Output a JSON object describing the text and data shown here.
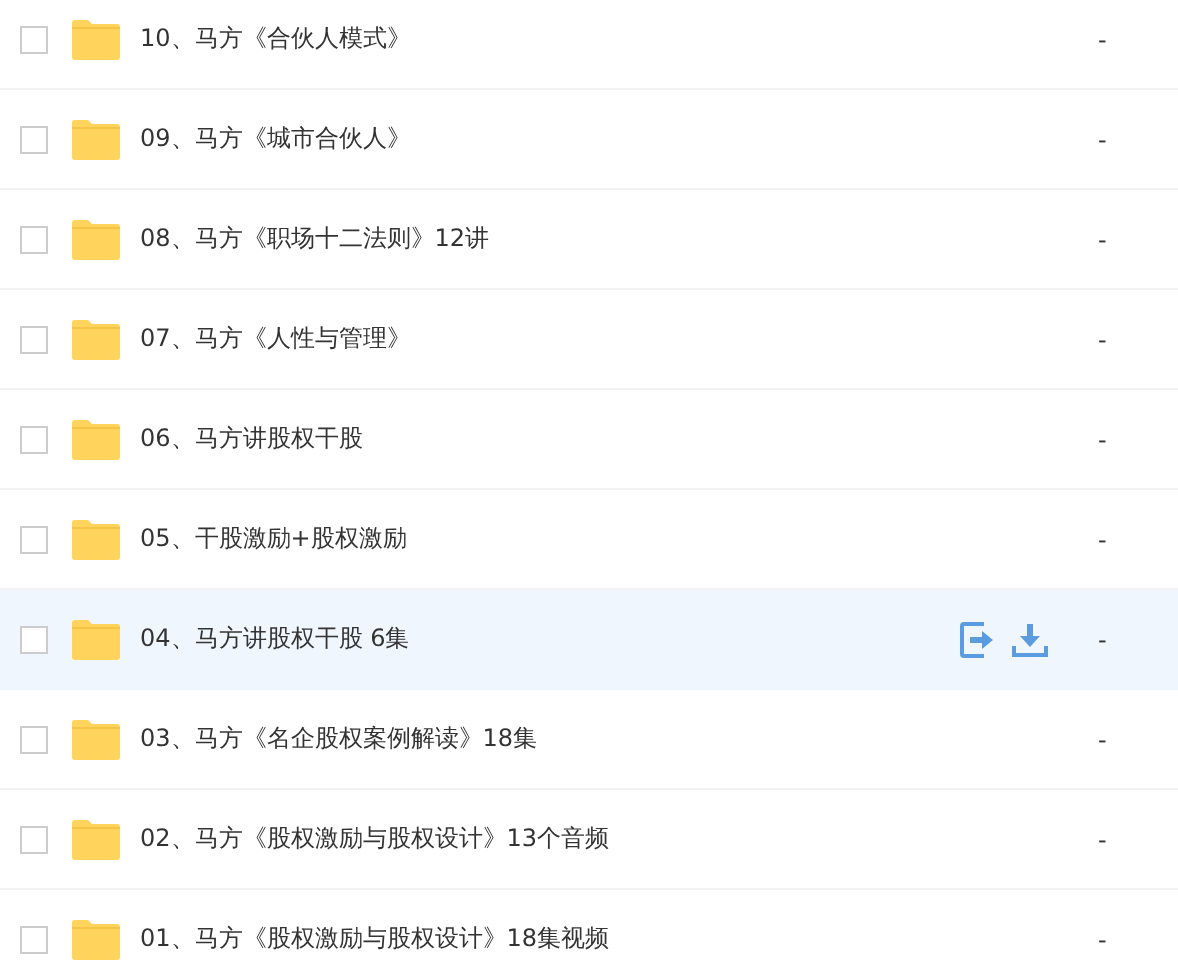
{
  "files": [
    {
      "name": "10、马方《合伙人模式》",
      "size": "-",
      "checked": false,
      "hovered": false
    },
    {
      "name": "09、马方《城市合伙人》",
      "size": "-",
      "checked": false,
      "hovered": false
    },
    {
      "name": "08、马方《职场十二法则》12讲",
      "size": "-",
      "checked": false,
      "hovered": false
    },
    {
      "name": "07、马方《人性与管理》",
      "size": "-",
      "checked": false,
      "hovered": false
    },
    {
      "name": "06、马方讲股权干股",
      "size": "-",
      "checked": false,
      "hovered": false
    },
    {
      "name": "05、干股激励+股权激励",
      "size": "-",
      "checked": false,
      "hovered": false
    },
    {
      "name": "04、马方讲股权干股 6集",
      "size": "-",
      "checked": false,
      "hovered": true
    },
    {
      "name": "03、马方《名企股权案例解读》18集",
      "size": "-",
      "checked": false,
      "hovered": false
    },
    {
      "name": "02、马方《股权激励与股权设计》13个音频",
      "size": "-",
      "checked": false,
      "hovered": false
    },
    {
      "name": "01、马方《股权激励与股权设计》18集视频",
      "size": "-",
      "checked": false,
      "hovered": false
    }
  ]
}
